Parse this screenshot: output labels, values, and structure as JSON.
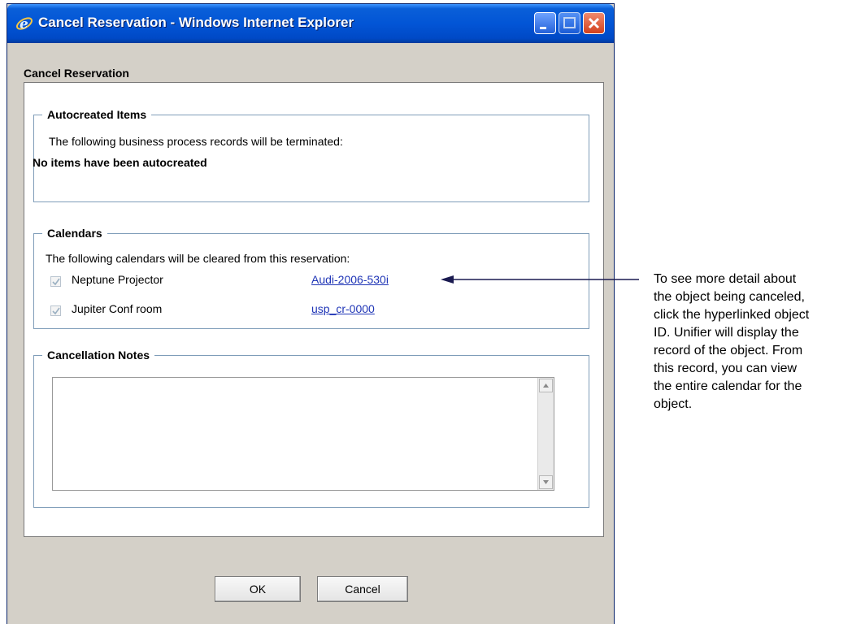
{
  "window": {
    "title": "Cancel Reservation - Windows Internet Explorer"
  },
  "dialog": {
    "heading": "Cancel Reservation",
    "autocreated": {
      "legend": "Autocreated Items",
      "description": "The following business process records will be terminated:",
      "status": "No items have been autocreated"
    },
    "calendars": {
      "legend": "Calendars",
      "description": "The following calendars will be cleared from this reservation:",
      "items": [
        {
          "name": "Neptune Projector",
          "id": "Audi-2006-530i",
          "checked": true
        },
        {
          "name": "Jupiter Conf room",
          "id": "usp_cr-0000",
          "checked": true
        }
      ]
    },
    "notes": {
      "legend": "Cancellation Notes",
      "value": ""
    },
    "buttons": {
      "ok": "OK",
      "cancel": "Cancel"
    }
  },
  "callout": {
    "lines": [
      "To see more detail about",
      "the object being canceled,",
      "click the hyperlinked object",
      "ID. Unifier will display the",
      "record of the object. From",
      "this record, you can view",
      "the entire calendar for the",
      "object."
    ]
  },
  "colors": {
    "titlebar": "#0255d6",
    "link": "#1f35b6",
    "window_bg": "#d4d0c8"
  }
}
